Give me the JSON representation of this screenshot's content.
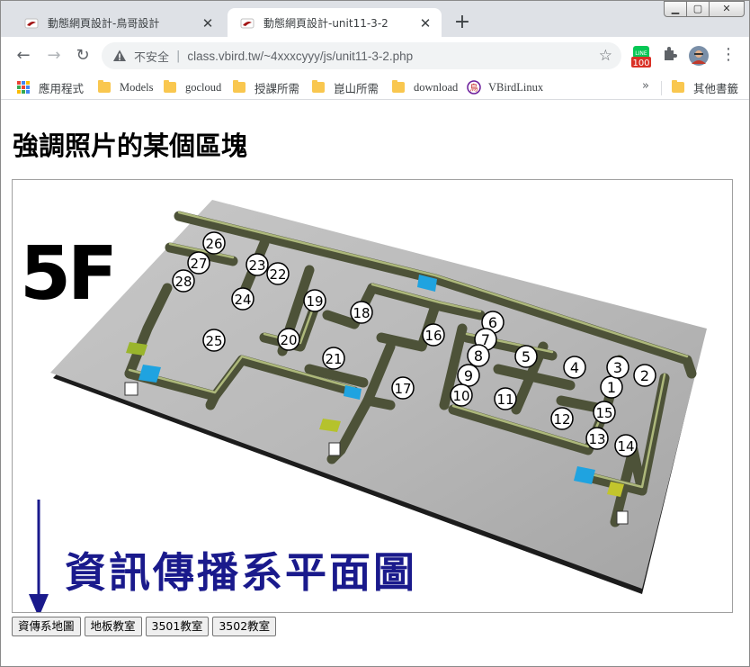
{
  "window": {
    "controls": {
      "minimize_icon": "minimize-icon",
      "maximize_icon": "maximize-icon",
      "close_icon": "close-icon"
    }
  },
  "tabs": [
    {
      "title": "動態網頁設計-鳥哥設計",
      "active": false
    },
    {
      "title": "動態網頁設計-unit11-3-2",
      "active": true
    }
  ],
  "toolbar": {
    "insecure_label": "不安全",
    "url": "class.vbird.tw/~4xxxcyyy/js/unit11-3-2.php",
    "extension_badge": "100"
  },
  "bookmarks": {
    "items": [
      {
        "label": "應用程式",
        "icon": "apps-grid-icon"
      },
      {
        "label": "Models",
        "icon": "folder-icon"
      },
      {
        "label": "gocloud",
        "icon": "folder-icon"
      },
      {
        "label": "授課所需",
        "icon": "folder-icon"
      },
      {
        "label": "崑山所需",
        "icon": "folder-icon"
      },
      {
        "label": "download",
        "icon": "folder-icon"
      },
      {
        "label": "VBirdLinux",
        "icon": "vbird-logo-icon"
      }
    ],
    "more": "»",
    "other": "其他書籤"
  },
  "page": {
    "heading": "強調照片的某個區塊",
    "floorplan": {
      "floor_label": "5F",
      "caption": "資訊傳播系平面圖",
      "room_numbers": [
        "1",
        "2",
        "3",
        "4",
        "5",
        "6",
        "7",
        "8",
        "9",
        "10",
        "11",
        "12",
        "13",
        "14",
        "15",
        "16",
        "17",
        "18",
        "19",
        "20",
        "21",
        "22",
        "23",
        "24",
        "25",
        "26",
        "27",
        "28"
      ]
    },
    "buttons": [
      "資傳系地圖",
      "地板教室",
      "3501教室",
      "3502教室"
    ]
  }
}
